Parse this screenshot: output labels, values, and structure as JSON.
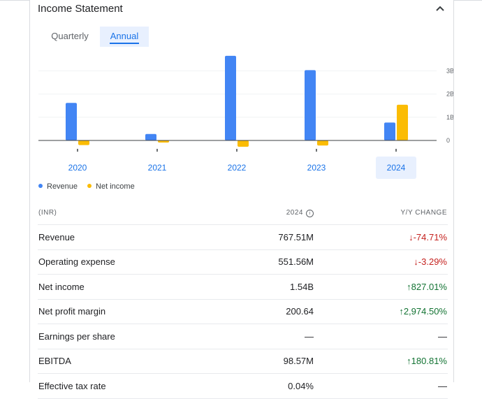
{
  "header": {
    "title": "Income Statement"
  },
  "tabs": [
    {
      "label": "Quarterly",
      "active": false
    },
    {
      "label": "Annual",
      "active": true
    }
  ],
  "chart_data": {
    "type": "bar",
    "categories": [
      "2020",
      "2021",
      "2022",
      "2023",
      "2024"
    ],
    "selected_category": "2024",
    "series": [
      {
        "name": "Revenue",
        "color": "#4285f4",
        "values": [
          1.62,
          0.28,
          3.65,
          3.03,
          0.77
        ]
      },
      {
        "name": "Net income",
        "color": "#fbbc04",
        "values": [
          -0.2,
          -0.09,
          -0.27,
          -0.22,
          1.54
        ]
      }
    ],
    "y_ticks": [
      "3B",
      "2B",
      "1B",
      "0"
    ],
    "y_tick_values": [
      3,
      2,
      1,
      0
    ],
    "ylim": [
      -0.35,
      3.8
    ],
    "units": "billions INR",
    "grid": true,
    "legend_position": "bottom-left"
  },
  "legend": [
    {
      "label": "Revenue",
      "color": "#4285f4"
    },
    {
      "label": "Net income",
      "color": "#fbbc04"
    }
  ],
  "table": {
    "headers": {
      "label": "(INR)",
      "year": "2024",
      "change": "Y/Y CHANGE"
    },
    "rows": [
      {
        "label": "Revenue",
        "value": "767.51M",
        "change": "-74.71%",
        "dir": "down"
      },
      {
        "label": "Operating expense",
        "value": "551.56M",
        "change": "-3.29%",
        "dir": "down"
      },
      {
        "label": "Net income",
        "value": "1.54B",
        "change": "827.01%",
        "dir": "up"
      },
      {
        "label": "Net profit margin",
        "value": "200.64",
        "change": "2,974.50%",
        "dir": "up"
      },
      {
        "label": "Earnings per share",
        "value": "—",
        "change": "—",
        "dir": "none"
      },
      {
        "label": "EBITDA",
        "value": "98.57M",
        "change": "180.81%",
        "dir": "up"
      },
      {
        "label": "Effective tax rate",
        "value": "0.04%",
        "change": "—",
        "dir": "none"
      }
    ]
  }
}
